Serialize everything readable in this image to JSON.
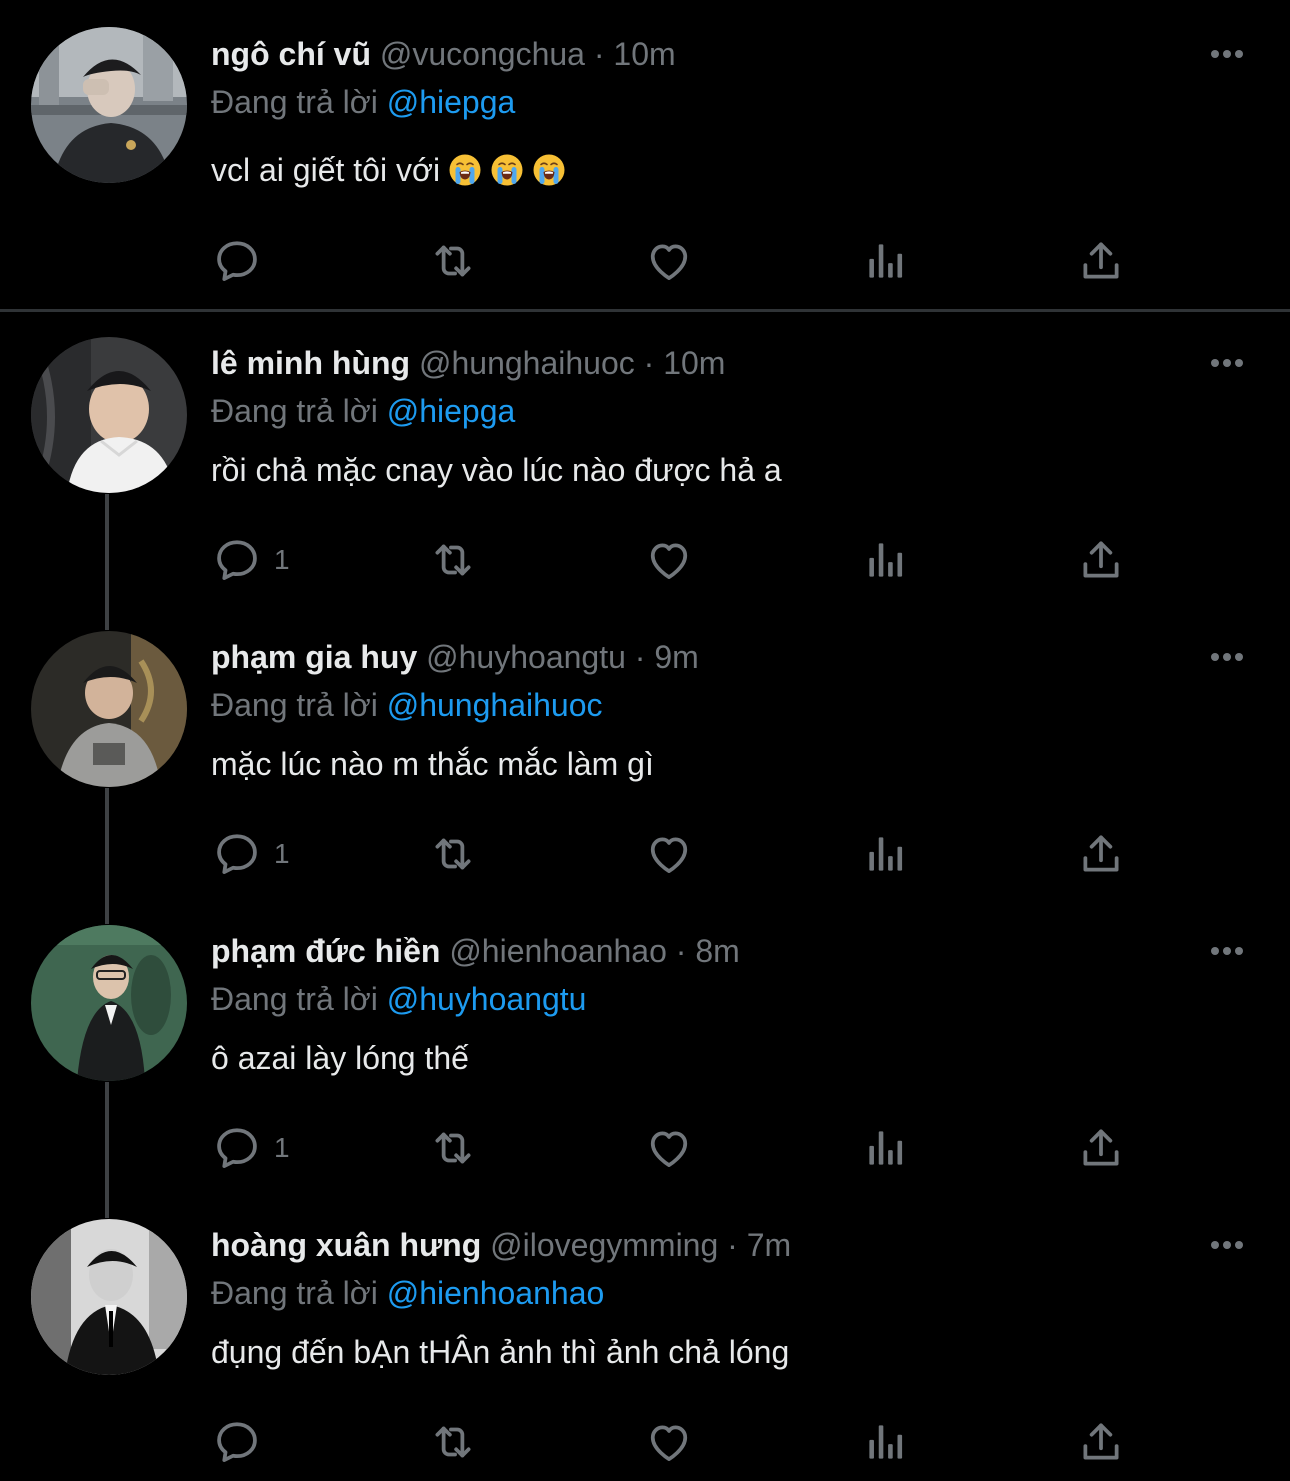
{
  "reply_prefix": "Đang trả lời",
  "colors": {
    "background": "#000000",
    "text": "#e7e9ea",
    "muted": "#71767b",
    "mention": "#1d9bf0",
    "divider": "#2f3336"
  },
  "tweets": [
    {
      "name": "ngô chí vũ",
      "handle": "@vucongchua",
      "separator": "·",
      "time": "10m",
      "reply_to": "@hiepga",
      "text": "vcl ai giết tôi với",
      "emojis": [
        "loudly-crying-face",
        "loudly-crying-face",
        "loudly-crying-face"
      ],
      "reply_count": ""
    },
    {
      "name": "lê minh hùng",
      "handle": "@hunghaihuoc",
      "separator": "·",
      "time": "10m",
      "reply_to": "@hiepga",
      "text": "rồi chả mặc cnay vào lúc nào được hả a",
      "reply_count": "1"
    },
    {
      "name": "phạm gia huy",
      "handle": "@huyhoangtu",
      "separator": "·",
      "time": "9m",
      "reply_to": "@hunghaihuoc",
      "text": "mặc lúc nào m thắc mắc làm gì",
      "reply_count": "1"
    },
    {
      "name": "phạm đức hiền",
      "handle": "@hienhoanhao",
      "separator": "·",
      "time": "8m",
      "reply_to": "@huyhoangtu",
      "text": "ô azai lày lóng thế",
      "reply_count": "1"
    },
    {
      "name": "hoàng xuân hưng",
      "handle": "@ilovegymming",
      "separator": "·",
      "time": "7m",
      "reply_to": "@hienhoanhao",
      "text": "đụng đến bẠn tHÂn ảnh thì ảnh chả lóng",
      "reply_count": ""
    }
  ],
  "icons": {
    "reply": "reply-bubble-icon",
    "retweet": "retweet-icon",
    "like": "heart-icon",
    "views": "views-bar-chart-icon",
    "share": "share-upload-icon",
    "more": "more-dots-icon"
  }
}
